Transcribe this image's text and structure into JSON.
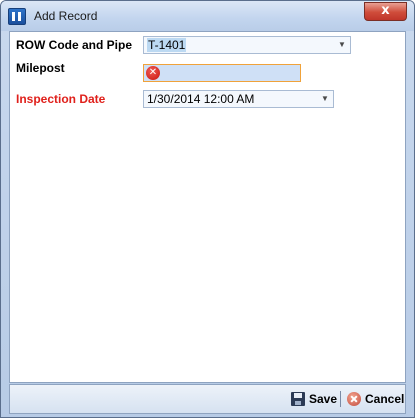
{
  "window": {
    "title": "Add Record",
    "close_glyph": "x"
  },
  "form": {
    "row_code": {
      "label": "ROW Code and Pipe",
      "value": "T-1401"
    },
    "milepost": {
      "label": "Milepost",
      "value": ""
    },
    "inspection_date": {
      "label": "Inspection Date",
      "value": "1/30/2014 12:00 AM"
    }
  },
  "footer": {
    "save_label": "Save",
    "separator": "|",
    "cancel_label": "Cancel"
  },
  "colors": {
    "required_label": "#e0201b",
    "error_border": "#f0a23a"
  },
  "icons": {
    "app": "app-window-icon",
    "error": "error-icon",
    "save": "save-icon",
    "cancel": "cancel-icon",
    "dropdown": "chevron-down-icon"
  }
}
